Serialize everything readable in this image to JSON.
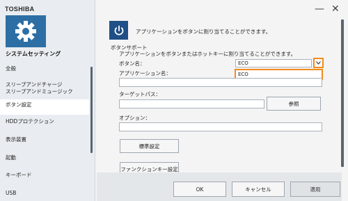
{
  "sidebar": {
    "brand": "TOSHIBA",
    "app_title": "システムセッティング",
    "items": [
      {
        "label": "全般"
      },
      {
        "label": "スリープアンドチャージ\nスリープアンドミュージック"
      },
      {
        "label": "ボタン設定"
      },
      {
        "label": "HDDプロテクション"
      },
      {
        "label": "表示装置"
      },
      {
        "label": "起動"
      },
      {
        "label": "キーボード"
      },
      {
        "label": "USB"
      }
    ]
  },
  "window": {
    "minimize": "—",
    "close": "✕"
  },
  "main": {
    "description": "アプリケーションをボタンに割り当てることができます。",
    "section_title": "ボタンサポート",
    "section_desc": "アプリケーションをボタンまたはホットキーに割り当てることができます。",
    "button_name_label": "ボタン名：",
    "button_name_value": "ECO",
    "dropdown_option": "ECO",
    "app_name_label": "アプリケーション名：",
    "app_name_value": "",
    "target_path_label": "ターゲットパス：",
    "target_path_value": "",
    "browse_button": "参照",
    "option_label": "オプション：",
    "option_value": "",
    "default_button": "標準設定",
    "function_key_button": "ファンクションキー設定"
  },
  "footer": {
    "ok": "OK",
    "cancel": "キャンセル",
    "apply": "適用"
  },
  "colors": {
    "accent_orange": "#f08c1c",
    "tile_blue": "#2d6fa4",
    "power_blue": "#1e4f86"
  }
}
